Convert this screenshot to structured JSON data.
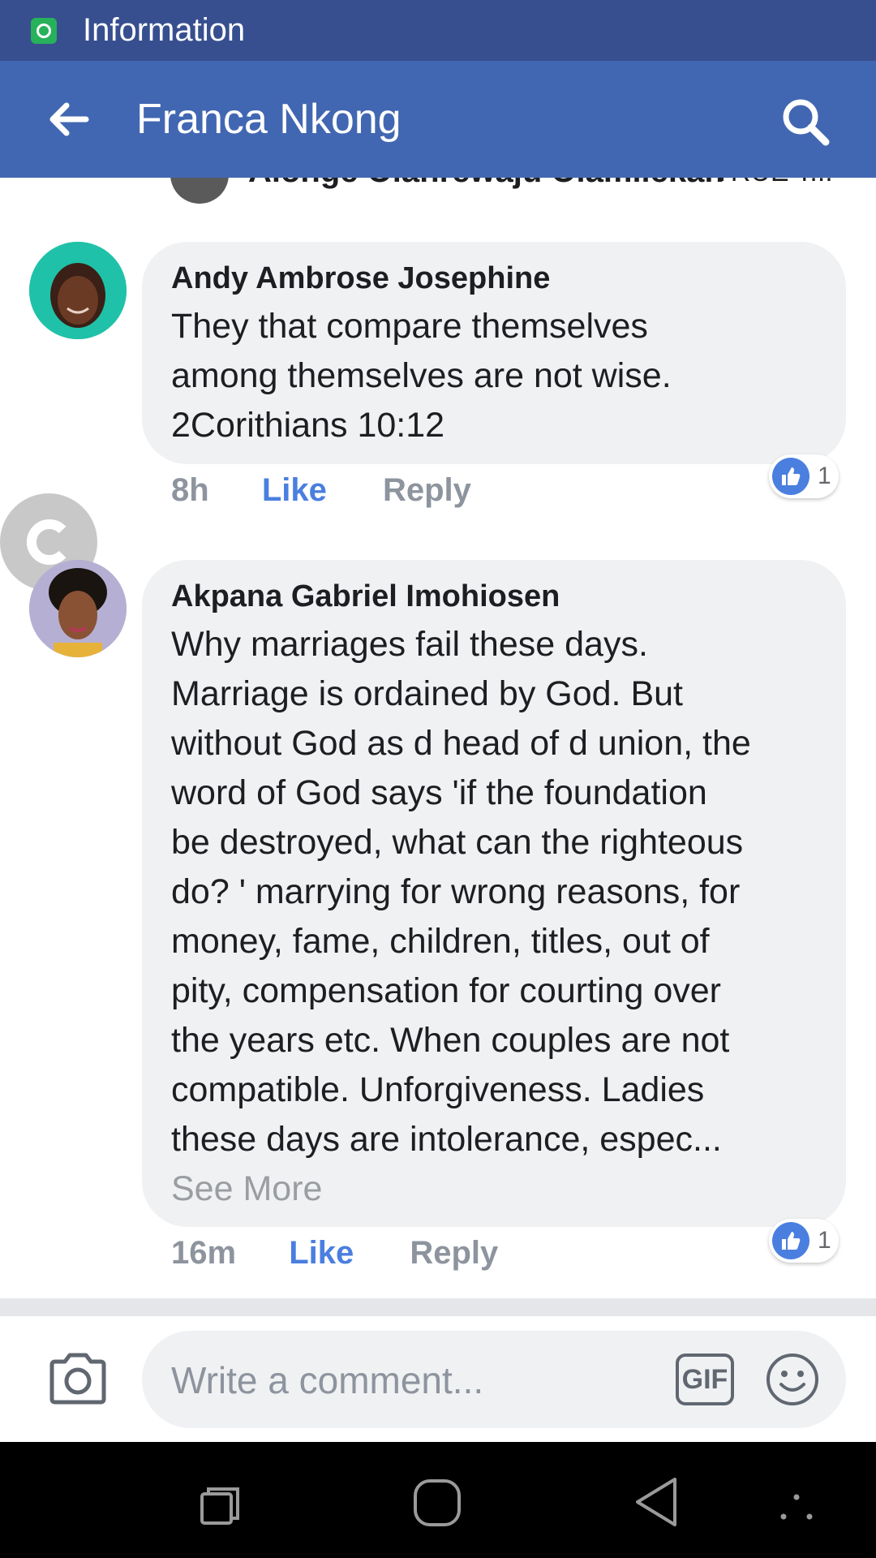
{
  "status_bar": {
    "app_title": "Information"
  },
  "header": {
    "title": "Franca Nkong"
  },
  "peek_comment": {
    "author": "Alonge Olanrewaju Olamilekan",
    "tag": "TRUE T..."
  },
  "comments": [
    {
      "author": "Andy Ambrose Josephine",
      "lines": [
        "They that compare themselves",
        "among themselves are not wise.",
        "2Corithians 10:12"
      ],
      "time": "8h",
      "like_label": "Like",
      "reply_label": "Reply",
      "reactions": "1"
    },
    {
      "author": "Akpana Gabriel Imohiosen",
      "lines": [
        "Why marriages fail these days.",
        "Marriage is ordained by God.  But",
        "without God as d head of d union, the",
        "word of God says 'if the foundation",
        "be destroyed, what can the righteous",
        "do? ' marrying for wrong reasons,  for",
        "money,  fame,  children,  titles,  out of",
        "pity,  compensation for courting over",
        "the years etc. When couples are not",
        "compatible. Unforgiveness.  Ladies",
        "these days are intolerance, espec..."
      ],
      "see_more": "See More",
      "time": "16m",
      "like_label": "Like",
      "reply_label": "Reply",
      "reactions": "1"
    }
  ],
  "composer": {
    "placeholder": "Write a comment...",
    "gif_label": "GIF"
  },
  "icons": {
    "back": "arrow-left-icon",
    "search": "search-icon",
    "camera": "camera-icon",
    "emoji": "smiley-icon",
    "thumb": "thumbs-up-icon",
    "chat_head": "chat-head-icon"
  },
  "colors": {
    "status_bar": "#374f8f",
    "header": "#4267b2",
    "link": "#4a7fe0",
    "bubble": "#f0f1f3"
  }
}
